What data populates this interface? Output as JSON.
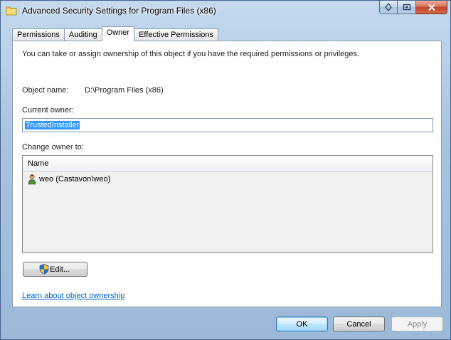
{
  "window": {
    "title": "Advanced Security Settings for Program Files (x86)"
  },
  "tabs": [
    {
      "label": "Permissions",
      "active": false
    },
    {
      "label": "Auditing",
      "active": false
    },
    {
      "label": "Owner",
      "active": true
    },
    {
      "label": "Effective Permissions",
      "active": false
    }
  ],
  "owner_tab": {
    "intro": "You can take or assign ownership of this object if you have the required permissions or privileges.",
    "object_name_label": "Object name:",
    "object_name_value": "D:\\Program Files (x86)",
    "current_owner_label": "Current owner:",
    "current_owner_value": "TrustedInstaller",
    "change_owner_label": "Change owner to:",
    "list": {
      "column_header": "Name",
      "rows": [
        {
          "name": "weo (Castavon\\weo)",
          "icon": "user-icon"
        }
      ]
    },
    "edit_button": "Edit...",
    "learn_link": "Learn about object ownership"
  },
  "footer": {
    "ok": "OK",
    "cancel": "Cancel",
    "apply": "Apply",
    "apply_enabled": false
  },
  "colors": {
    "selection": "#3399ff",
    "link": "#0066cc",
    "frame": "#a9c4e1"
  }
}
